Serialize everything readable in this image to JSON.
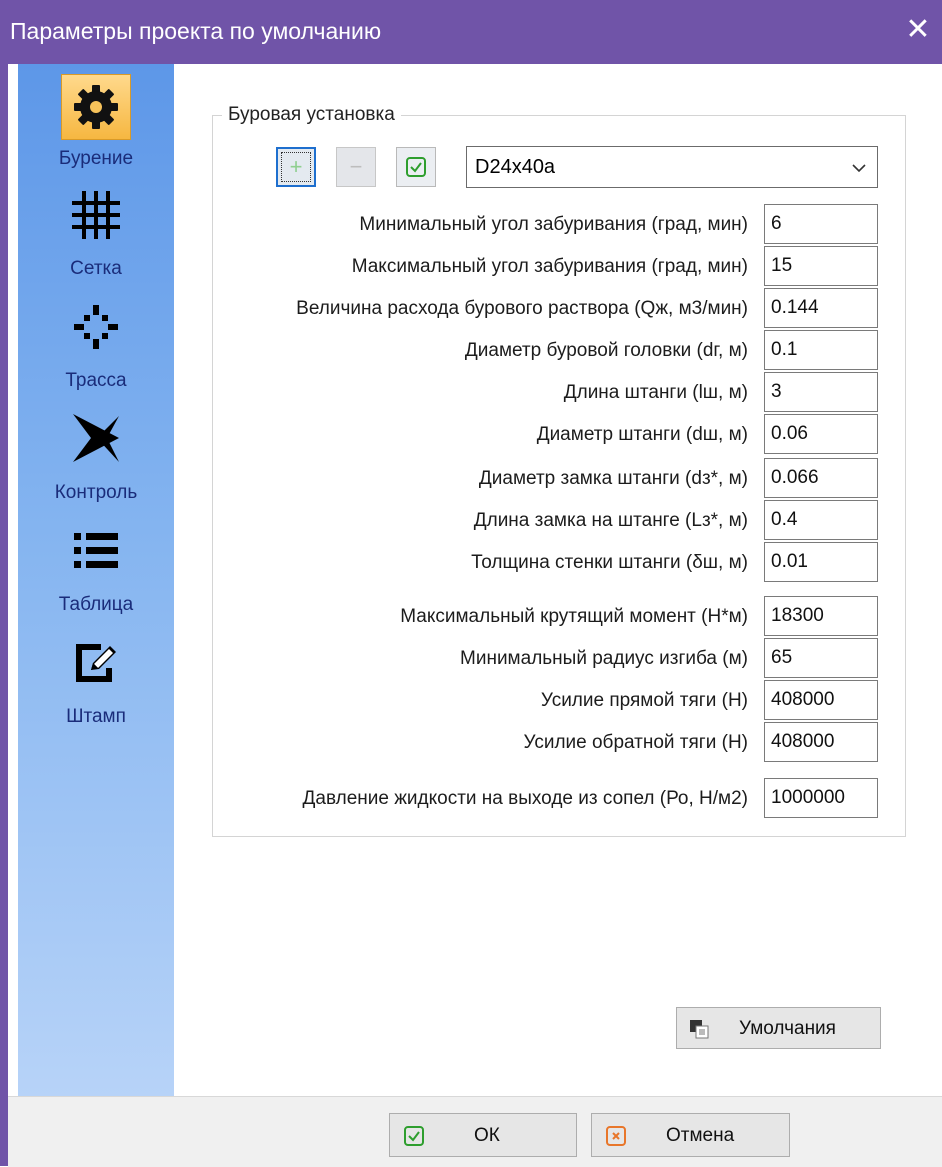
{
  "window": {
    "title": "Параметры проекта по умолчанию",
    "accent": "#7054a8"
  },
  "sidebar": {
    "items": [
      {
        "label": "Бурение",
        "icon": "gear-icon",
        "active": true
      },
      {
        "label": "Сетка",
        "icon": "grid-icon",
        "active": false
      },
      {
        "label": "Трасса",
        "icon": "crosshair-icon",
        "active": false
      },
      {
        "label": "Контроль",
        "icon": "drill-control-icon",
        "active": false
      },
      {
        "label": "Таблица",
        "icon": "list-icon",
        "active": false
      },
      {
        "label": "Штамп",
        "icon": "edit-document-icon",
        "active": false
      }
    ]
  },
  "group": {
    "title": "Буровая установка",
    "rig_selected": "D24x40a",
    "fields": [
      {
        "label": "Минимальный угол забуривания (град, мин)",
        "value": "6"
      },
      {
        "label": "Максимальный угол забуривания (град, мин)",
        "value": "15"
      },
      {
        "label": "Величина расхода бурового раствора (Qж, м3/мин)",
        "value": "0.144"
      },
      {
        "label": "Диаметр буровой головки (dг, м)",
        "value": "0.1"
      },
      {
        "label": "Длина штанги (lш, м)",
        "value": "3"
      },
      {
        "label": "Диаметр штанги (dш, м)",
        "value": "0.06"
      },
      {
        "label": "Диаметр замка штанги (dз*, м)",
        "value": "0.066"
      },
      {
        "label": "Длина замка на штанге (Lз*, м)",
        "value": "0.4"
      },
      {
        "label": "Толщина стенки штанги (δш, м)",
        "value": "0.01"
      },
      {
        "label": "Максимальный крутящий момент (Н*м)",
        "value": "18300"
      },
      {
        "label": "Минимальный радиус изгиба (м)",
        "value": "65"
      },
      {
        "label": "Усилие прямой тяги (Н)",
        "value": "408000"
      },
      {
        "label": "Усилие обратной тяги (Н)",
        "value": "408000"
      },
      {
        "label": "Давление жидкости на выходе из сопел (Ро, Н/м2)",
        "value": "1000000"
      }
    ]
  },
  "buttons": {
    "defaults": "Умолчания",
    "ok": "ОК",
    "cancel": "Отмена"
  }
}
